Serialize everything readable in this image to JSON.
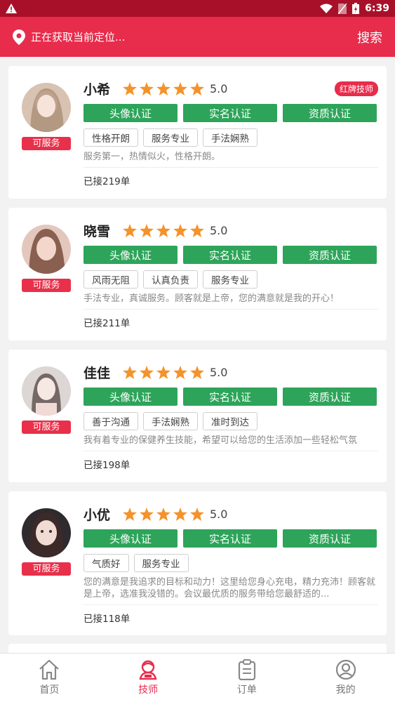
{
  "status_bar": {
    "time": "6:39"
  },
  "header": {
    "location_text": "正在获取当前定位...",
    "search_label": "搜索"
  },
  "technicians": [
    {
      "name": "小希",
      "rating": "5.0",
      "badge": "红牌技师",
      "status": "可服务",
      "certs": [
        "头像认证",
        "实名认证",
        "资质认证"
      ],
      "tags": [
        "性格开朗",
        "服务专业",
        "手法娴熟"
      ],
      "description": "服务第一，热情似火，性格开朗。",
      "orders": "已接219单"
    },
    {
      "name": "晓雪",
      "rating": "5.0",
      "badge": "",
      "status": "可服务",
      "certs": [
        "头像认证",
        "实名认证",
        "资质认证"
      ],
      "tags": [
        "风雨无阻",
        "认真负责",
        "服务专业"
      ],
      "description": "手法专业，真诚服务。顾客就是上帝，您的满意就是我的开心！",
      "orders": "已接211单"
    },
    {
      "name": "佳佳",
      "rating": "5.0",
      "badge": "",
      "status": "可服务",
      "certs": [
        "头像认证",
        "实名认证",
        "资质认证"
      ],
      "tags": [
        "善于沟通",
        "手法娴熟",
        "准时到达"
      ],
      "description": "我有着专业的保健养生技能，希望可以给您的生活添加一些轻松气氛",
      "orders": "已接198单"
    },
    {
      "name": "小优",
      "rating": "5.0",
      "badge": "",
      "status": "可服务",
      "certs": [
        "头像认证",
        "实名认证",
        "资质认证"
      ],
      "tags": [
        "气质好",
        "服务专业"
      ],
      "description": "您的满意是我追求的目标和动力！这里给您身心充电，精力充沛！顾客就是上帝，选准我没错的。会议最优质的服务带给您最舒适的...",
      "orders": "已接118单"
    }
  ],
  "nav": [
    {
      "label": "首页",
      "icon": "home-icon"
    },
    {
      "label": "技师",
      "icon": "technician-icon"
    },
    {
      "label": "订单",
      "icon": "clipboard-icon"
    },
    {
      "label": "我的",
      "icon": "user-icon"
    }
  ],
  "colors": {
    "primary": "#e82c4c",
    "status_bar": "#a8102a",
    "cert_green": "#2da45a",
    "star": "#f5922a"
  }
}
